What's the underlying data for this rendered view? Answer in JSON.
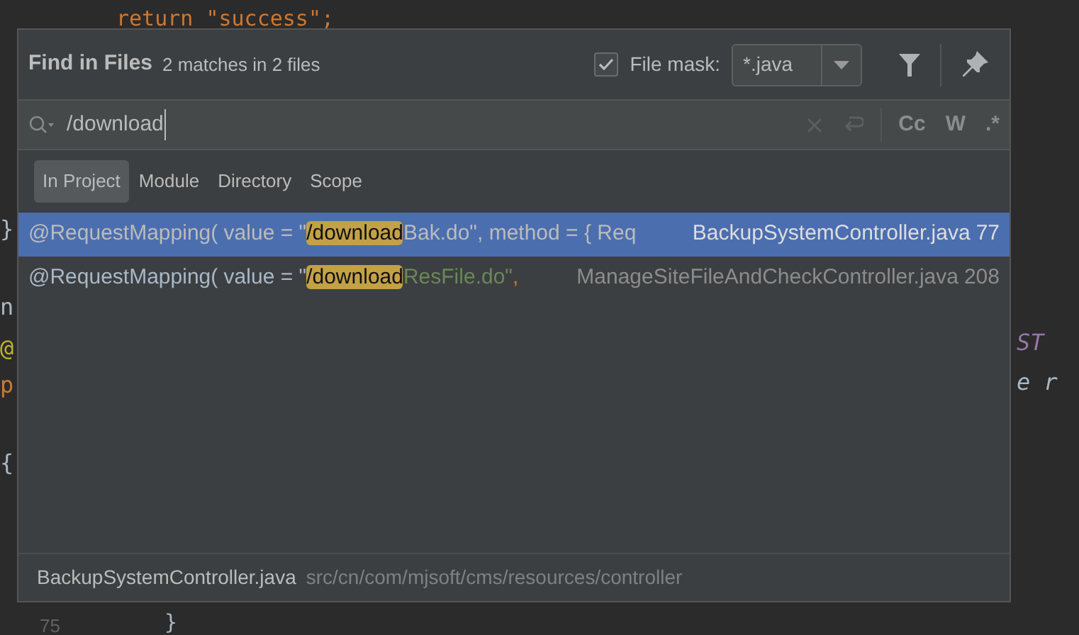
{
  "editor": {
    "top_line": "return \"success\";",
    "left_fragments": [
      "}",
      "n",
      "@",
      "p",
      "{"
    ],
    "right_fragments": [
      "ST",
      "e r"
    ],
    "bottom_line": {
      "number": "75",
      "code": "}"
    }
  },
  "dialog": {
    "title": "Find in Files",
    "summary": "2 matches in 2 files",
    "file_mask": {
      "checked": true,
      "label": "File mask:",
      "value": "*.java"
    },
    "search": {
      "value": "/download",
      "options": [
        "Cc",
        "W",
        ".*"
      ]
    },
    "scopes": [
      {
        "label": "In Project",
        "selected": true
      },
      {
        "label": "Module",
        "selected": false
      },
      {
        "label": "Directory",
        "selected": false
      },
      {
        "label": "Scope",
        "selected": false
      }
    ],
    "results": [
      {
        "prefix": "@RequestMapping( value = \"",
        "match": "/download",
        "string_rest": "Bak.do\"",
        "tail": ", method = { Req",
        "file": "BackupSystemController.java",
        "line": "77",
        "selected": true
      },
      {
        "prefix": "@RequestMapping( value = \"",
        "match": "/download",
        "string_rest": "ResFile.do\"",
        "tail": ",",
        "file": "ManageSiteFileAndCheckController.java",
        "line": "208",
        "selected": false
      }
    ],
    "footer": {
      "file": "BackupSystemController.java",
      "path": "src/cn/com/mjsoft/cms/resources/controller"
    }
  }
}
